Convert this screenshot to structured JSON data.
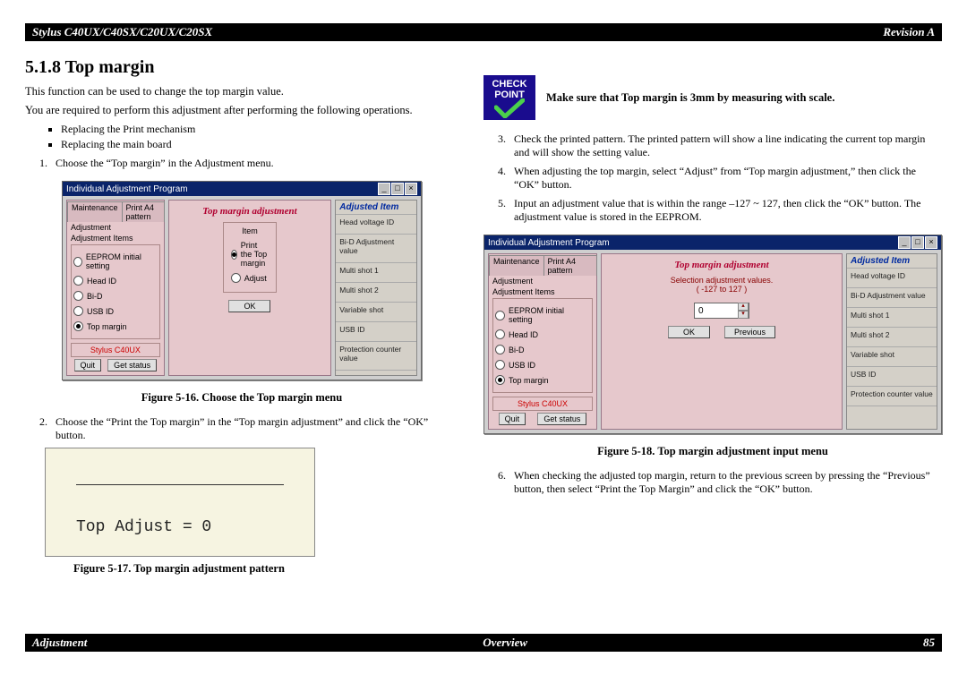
{
  "header": {
    "left": "Stylus C40UX/C40SX/C20UX/C20SX",
    "right": "Revision A"
  },
  "footer": {
    "left": "Adjustment",
    "center": "Overview",
    "right": "85"
  },
  "heading": "5.1.8  Top margin",
  "left": {
    "p1": "This function can be used to change the top margin value.",
    "p2": "You are required to perform this adjustment after performing the following operations.",
    "bullets": [
      "Replacing the Print mechanism",
      "Replacing the main board"
    ],
    "step1": "Choose the “Top margin” in the Adjustment menu.",
    "fig16": "Figure 5-16.  Choose the Top margin menu",
    "step2": "Choose the “Print the Top margin” in the “Top margin adjustment” and click the “OK” button.",
    "fig17": "Figure 5-17.  Top margin adjustment pattern",
    "paper_text": "Top Adjust = 0"
  },
  "right": {
    "check_label_line1": "CHECK",
    "check_label_line2": "POINT",
    "check_text": "Make sure that Top margin is 3mm by measuring with scale.",
    "step3": "Check the printed pattern. The printed pattern will show a line indicating the current top margin and will show the setting value.",
    "step4": "When adjusting the top margin, select “Adjust” from “Top margin adjustment,” then click the “OK” button.",
    "step5": "Input an adjustment value that is within the range –127 ~ 127, then click the “OK” button. The adjustment value is stored in the EEPROM.",
    "fig18": "Figure 5-18.  Top margin adjustment input menu",
    "step6": "When checking the adjusted top margin, return to the previous screen by pressing the “Previous” button, then select “Print the Top Margin” and click the “OK” button."
  },
  "screenshot": {
    "title": "Individual Adjustment Program",
    "tab1": "Maintenance",
    "tab2": "Print A4 pattern",
    "adjlabel": "Adjustment",
    "grouplabel": "Adjustment Items",
    "r1": "EEPROM initial setting",
    "r2": "Head ID",
    "r3": "Bi-D",
    "r4": "USB ID",
    "r5": "Top margin",
    "model": "Stylus C40UX",
    "quit": "Quit",
    "getstatus": "Get status",
    "midtitle": "Top margin adjustment",
    "itemlabel": "Item",
    "mr1": "Print the Top margin",
    "mr2": "Adjust",
    "ok": "OK",
    "previous": "Previous",
    "sel_label": "Selection adjustment values.",
    "sel_range": "( -127 to 127 )",
    "sel_value": "0",
    "adj_item": "Adjusted Item",
    "ri1": "Head voltage ID",
    "ri2": "Bi-D Adjustment value",
    "ri3": "Multi shot 1",
    "ri4": "Multi shot 2",
    "ri5": "Variable shot",
    "ri6": "USB ID",
    "ri7": "Protection counter value"
  }
}
